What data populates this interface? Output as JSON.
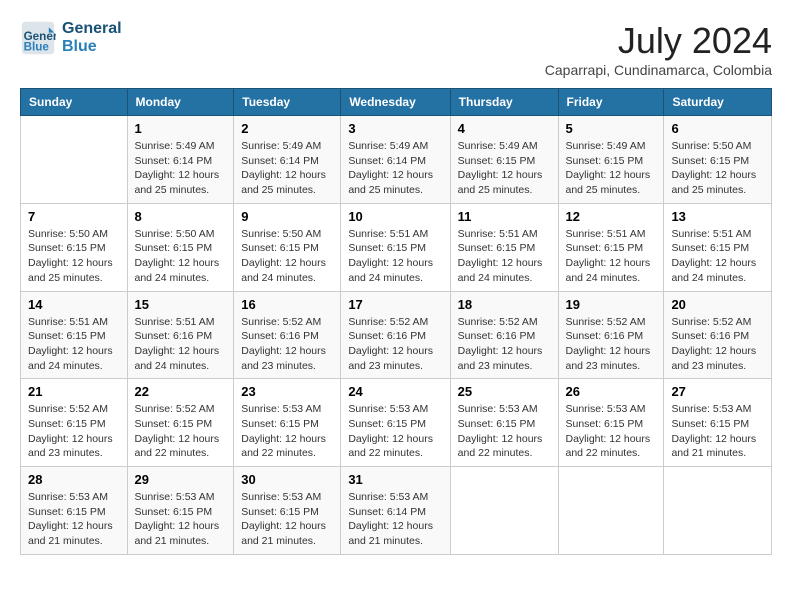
{
  "header": {
    "logo_line1": "General",
    "logo_line2": "Blue",
    "title": "July 2024",
    "location": "Caparrapi, Cundinamarca, Colombia"
  },
  "calendar": {
    "days_of_week": [
      "Sunday",
      "Monday",
      "Tuesday",
      "Wednesday",
      "Thursday",
      "Friday",
      "Saturday"
    ],
    "weeks": [
      [
        {
          "day": "",
          "info": ""
        },
        {
          "day": "1",
          "info": "Sunrise: 5:49 AM\nSunset: 6:14 PM\nDaylight: 12 hours\nand 25 minutes."
        },
        {
          "day": "2",
          "info": "Sunrise: 5:49 AM\nSunset: 6:14 PM\nDaylight: 12 hours\nand 25 minutes."
        },
        {
          "day": "3",
          "info": "Sunrise: 5:49 AM\nSunset: 6:14 PM\nDaylight: 12 hours\nand 25 minutes."
        },
        {
          "day": "4",
          "info": "Sunrise: 5:49 AM\nSunset: 6:15 PM\nDaylight: 12 hours\nand 25 minutes."
        },
        {
          "day": "5",
          "info": "Sunrise: 5:49 AM\nSunset: 6:15 PM\nDaylight: 12 hours\nand 25 minutes."
        },
        {
          "day": "6",
          "info": "Sunrise: 5:50 AM\nSunset: 6:15 PM\nDaylight: 12 hours\nand 25 minutes."
        }
      ],
      [
        {
          "day": "7",
          "info": "Sunrise: 5:50 AM\nSunset: 6:15 PM\nDaylight: 12 hours\nand 25 minutes."
        },
        {
          "day": "8",
          "info": "Sunrise: 5:50 AM\nSunset: 6:15 PM\nDaylight: 12 hours\nand 24 minutes."
        },
        {
          "day": "9",
          "info": "Sunrise: 5:50 AM\nSunset: 6:15 PM\nDaylight: 12 hours\nand 24 minutes."
        },
        {
          "day": "10",
          "info": "Sunrise: 5:51 AM\nSunset: 6:15 PM\nDaylight: 12 hours\nand 24 minutes."
        },
        {
          "day": "11",
          "info": "Sunrise: 5:51 AM\nSunset: 6:15 PM\nDaylight: 12 hours\nand 24 minutes."
        },
        {
          "day": "12",
          "info": "Sunrise: 5:51 AM\nSunset: 6:15 PM\nDaylight: 12 hours\nand 24 minutes."
        },
        {
          "day": "13",
          "info": "Sunrise: 5:51 AM\nSunset: 6:15 PM\nDaylight: 12 hours\nand 24 minutes."
        }
      ],
      [
        {
          "day": "14",
          "info": "Sunrise: 5:51 AM\nSunset: 6:15 PM\nDaylight: 12 hours\nand 24 minutes."
        },
        {
          "day": "15",
          "info": "Sunrise: 5:51 AM\nSunset: 6:16 PM\nDaylight: 12 hours\nand 24 minutes."
        },
        {
          "day": "16",
          "info": "Sunrise: 5:52 AM\nSunset: 6:16 PM\nDaylight: 12 hours\nand 23 minutes."
        },
        {
          "day": "17",
          "info": "Sunrise: 5:52 AM\nSunset: 6:16 PM\nDaylight: 12 hours\nand 23 minutes."
        },
        {
          "day": "18",
          "info": "Sunrise: 5:52 AM\nSunset: 6:16 PM\nDaylight: 12 hours\nand 23 minutes."
        },
        {
          "day": "19",
          "info": "Sunrise: 5:52 AM\nSunset: 6:16 PM\nDaylight: 12 hours\nand 23 minutes."
        },
        {
          "day": "20",
          "info": "Sunrise: 5:52 AM\nSunset: 6:16 PM\nDaylight: 12 hours\nand 23 minutes."
        }
      ],
      [
        {
          "day": "21",
          "info": "Sunrise: 5:52 AM\nSunset: 6:15 PM\nDaylight: 12 hours\nand 23 minutes."
        },
        {
          "day": "22",
          "info": "Sunrise: 5:52 AM\nSunset: 6:15 PM\nDaylight: 12 hours\nand 22 minutes."
        },
        {
          "day": "23",
          "info": "Sunrise: 5:53 AM\nSunset: 6:15 PM\nDaylight: 12 hours\nand 22 minutes."
        },
        {
          "day": "24",
          "info": "Sunrise: 5:53 AM\nSunset: 6:15 PM\nDaylight: 12 hours\nand 22 minutes."
        },
        {
          "day": "25",
          "info": "Sunrise: 5:53 AM\nSunset: 6:15 PM\nDaylight: 12 hours\nand 22 minutes."
        },
        {
          "day": "26",
          "info": "Sunrise: 5:53 AM\nSunset: 6:15 PM\nDaylight: 12 hours\nand 22 minutes."
        },
        {
          "day": "27",
          "info": "Sunrise: 5:53 AM\nSunset: 6:15 PM\nDaylight: 12 hours\nand 21 minutes."
        }
      ],
      [
        {
          "day": "28",
          "info": "Sunrise: 5:53 AM\nSunset: 6:15 PM\nDaylight: 12 hours\nand 21 minutes."
        },
        {
          "day": "29",
          "info": "Sunrise: 5:53 AM\nSunset: 6:15 PM\nDaylight: 12 hours\nand 21 minutes."
        },
        {
          "day": "30",
          "info": "Sunrise: 5:53 AM\nSunset: 6:15 PM\nDaylight: 12 hours\nand 21 minutes."
        },
        {
          "day": "31",
          "info": "Sunrise: 5:53 AM\nSunset: 6:14 PM\nDaylight: 12 hours\nand 21 minutes."
        },
        {
          "day": "",
          "info": ""
        },
        {
          "day": "",
          "info": ""
        },
        {
          "day": "",
          "info": ""
        }
      ]
    ]
  }
}
